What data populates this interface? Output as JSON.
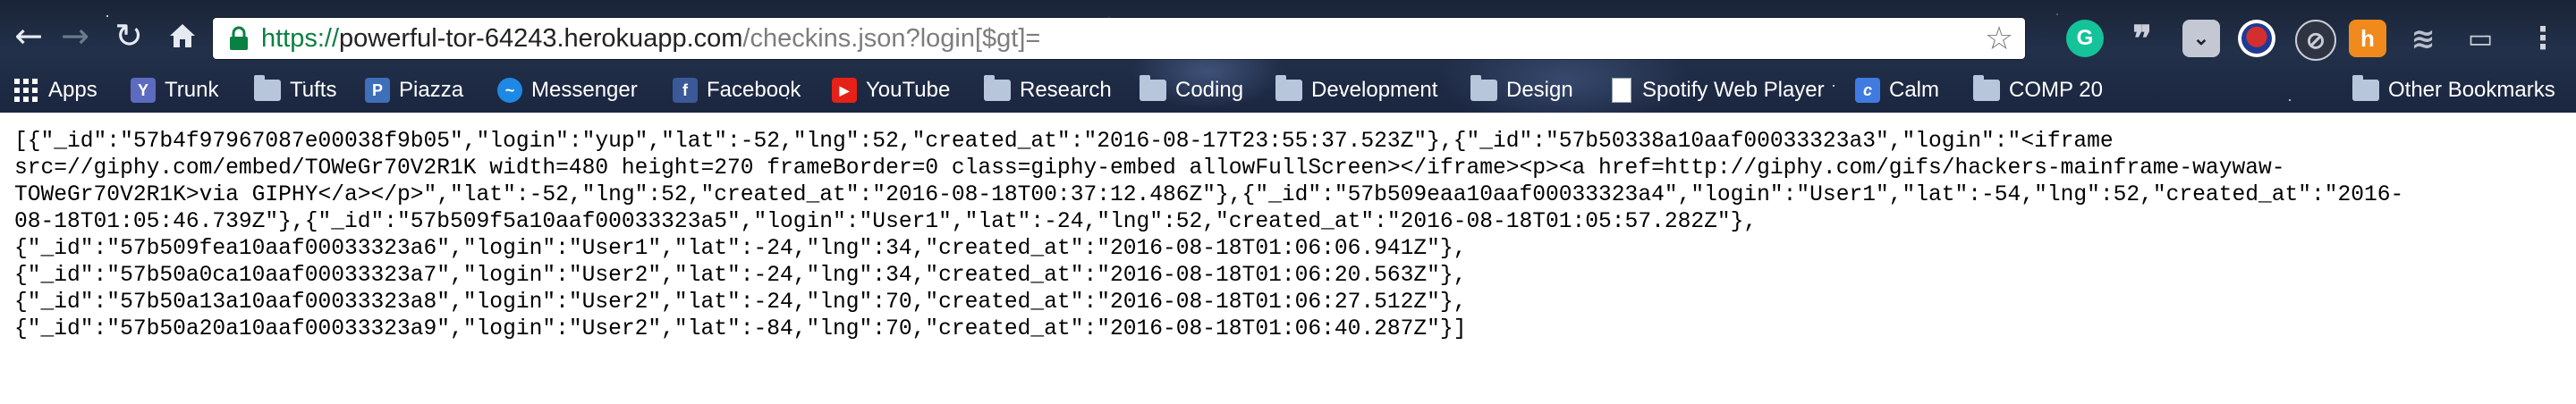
{
  "browser": {
    "address_bar": {
      "scheme": "https://",
      "host": "powerful-tor-64243.herokuapp.com",
      "path": "/checkins.json?login[$gt]=",
      "secure": true,
      "scheme_color": "#0b8043"
    },
    "extensions": [
      {
        "name": "grammarly-icon",
        "glyph": "G"
      },
      {
        "name": "quote-icon",
        "glyph": "❞"
      },
      {
        "name": "pocket-icon",
        "glyph": "⌄"
      },
      {
        "name": "badge-icon",
        "glyph": ""
      },
      {
        "name": "block-icon",
        "glyph": "⊘"
      },
      {
        "name": "honey-icon",
        "glyph": "h"
      },
      {
        "name": "layers-icon",
        "glyph": "≋"
      },
      {
        "name": "cast-icon",
        "glyph": "▭"
      },
      {
        "name": "menu-icon",
        "glyph": "⋮"
      }
    ]
  },
  "bookmarks": {
    "items": [
      {
        "label": "Apps",
        "icon": "apps-grid-icon",
        "color": "#ffffff"
      },
      {
        "label": "Trunk",
        "icon": "trunk-icon",
        "color": "#5c6bc0",
        "glyph": "Y"
      },
      {
        "label": "Tufts",
        "icon": "folder-icon"
      },
      {
        "label": "Piazza",
        "icon": "piazza-icon",
        "color": "#3e6fb8",
        "glyph": "P"
      },
      {
        "label": "Messenger",
        "icon": "messenger-icon",
        "color": "#1e88e5",
        "glyph": "~"
      },
      {
        "label": "Facebook",
        "icon": "facebook-icon",
        "color": "#3b5998",
        "glyph": "f"
      },
      {
        "label": "YouTube",
        "icon": "youtube-icon",
        "color": "#e62117",
        "glyph": "▶"
      },
      {
        "label": "Research",
        "icon": "folder-icon"
      },
      {
        "label": "Coding",
        "icon": "folder-icon"
      },
      {
        "label": "Development",
        "icon": "folder-icon"
      },
      {
        "label": "Design",
        "icon": "folder-icon"
      },
      {
        "label": "Spotify Web Player",
        "icon": "document-icon"
      },
      {
        "label": "Calm",
        "icon": "calm-icon",
        "color": "#3f7be0",
        "glyph": "c"
      },
      {
        "label": "COMP 20",
        "icon": "folder-icon"
      }
    ],
    "other": {
      "label": "Other Bookmarks",
      "icon": "folder-icon"
    }
  },
  "page": {
    "json_text": "[{\"_id\":\"57b4f97967087e00038f9b05\",\"login\":\"yup\",\"lat\":-52,\"lng\":52,\"created_at\":\"2016-08-17T23:55:37.523Z\"},{\"_id\":\"57b50338a10aaf00033323a3\",\"login\":\"<iframe\nsrc=//giphy.com/embed/TOWeGr70V2R1K width=480 height=270 frameBorder=0 class=giphy-embed allowFullScreen></iframe><p><a href=http://giphy.com/gifs/hackers-mainframe-waywaw-\nTOWeGr70V2R1K>via GIPHY</a></p>\",\"lat\":-52,\"lng\":52,\"created_at\":\"2016-08-18T00:37:12.486Z\"},{\"_id\":\"57b509eaa10aaf00033323a4\",\"login\":\"User1\",\"lat\":-54,\"lng\":52,\"created_at\":\"2016-\n08-18T01:05:46.739Z\"},{\"_id\":\"57b509f5a10aaf00033323a5\",\"login\":\"User1\",\"lat\":-24,\"lng\":52,\"created_at\":\"2016-08-18T01:05:57.282Z\"},\n{\"_id\":\"57b509fea10aaf00033323a6\",\"login\":\"User1\",\"lat\":-24,\"lng\":34,\"created_at\":\"2016-08-18T01:06:06.941Z\"},\n{\"_id\":\"57b50a0ca10aaf00033323a7\",\"login\":\"User2\",\"lat\":-24,\"lng\":34,\"created_at\":\"2016-08-18T01:06:20.563Z\"},\n{\"_id\":\"57b50a13a10aaf00033323a8\",\"login\":\"User2\",\"lat\":-24,\"lng\":70,\"created_at\":\"2016-08-18T01:06:27.512Z\"},\n{\"_id\":\"57b50a20a10aaf00033323a9\",\"login\":\"User2\",\"lat\":-84,\"lng\":70,\"created_at\":\"2016-08-18T01:06:40.287Z\"}]"
  }
}
